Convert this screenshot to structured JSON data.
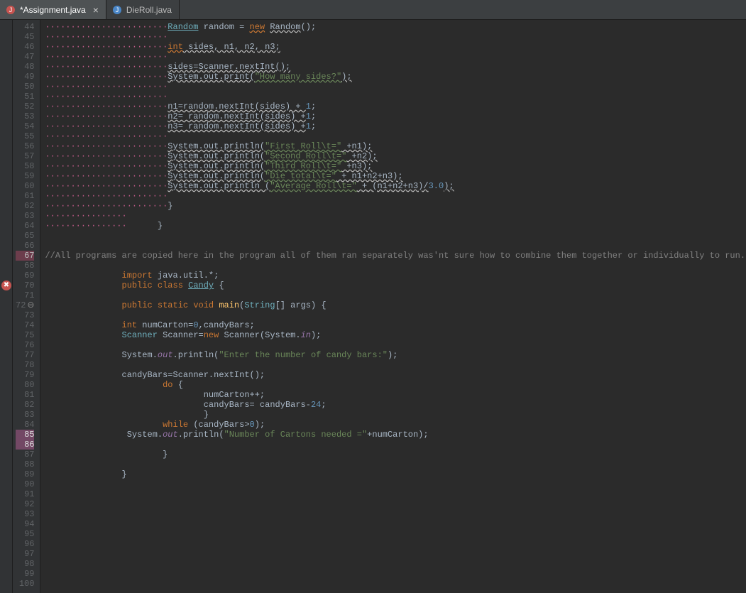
{
  "tabs": {
    "active": {
      "label": "*Assignment.java"
    },
    "inactive": {
      "label": "DieRoll.java"
    }
  },
  "gutter": {
    "start": 44,
    "end": 100,
    "quickfix_lines": [
      67
    ],
    "quickfix2_lines": [
      85,
      86
    ],
    "fold_line": 72
  },
  "marker": {
    "error_at": 70
  },
  "code": {
    "dots4": "················",
    "dots2": "········",
    "l44": {
      "a": "Random",
      "b": " random = ",
      "c": "new",
      "d": " ",
      "e": "Random",
      "f": "();"
    },
    "l46": {
      "a": "int",
      "b": " sides, n1, n2, n3;"
    },
    "l48": "sides=Scanner.nextInt();",
    "l49": {
      "a": "System.out.print(",
      "b": "\"How many sides?\"",
      "c": ");"
    },
    "l52": {
      "a": "n1=random.nextInt(sides) + ",
      "b": "1",
      "c": ";"
    },
    "l53": {
      "a": "n2= random.nextInt(sides) +",
      "b": "1",
      "c": ";"
    },
    "l54": {
      "a": "n3= random.nextInt(sides) +",
      "b": "1",
      "c": ";"
    },
    "l56": {
      "a": "System.out.println(",
      "b": "\"First Roll\\t=\"",
      "c": " +n1);"
    },
    "l57": {
      "a": "System.out.println(",
      "b": "\"Second Roll\\t=\"",
      "c": " +n2);"
    },
    "l58": {
      "a": "System.out.println(",
      "b": "\"Third Roll\\t=\"",
      "c": " +n3);"
    },
    "l59": {
      "a": "System.out.println(",
      "b": "\"Die total\\t=\"",
      "c": " + n1+n2+n3);"
    },
    "l60": {
      "a": "System.out.println (",
      "b": "\"Average Roll\\t=\"",
      "c": " + (n1+n2+n3)/",
      "d": "3.0",
      "e": ");"
    },
    "l62": "}",
    "l64": "}",
    "l67": "//All programs are copied here in the program all of them ran separately was'nt sure how to combine them together or individually to run.",
    "l69": {
      "a": "import",
      "b": " java.util.*;"
    },
    "l70": {
      "a": "public class ",
      "b": "Candy",
      "c": " {"
    },
    "l72": {
      "a": "public static void ",
      "b": "main",
      "c": "(",
      "d": "String",
      "e": "[] ",
      "f": "args",
      "g": ") {"
    },
    "l74": {
      "a": "int",
      "b": " numCarton=",
      "c": "0",
      "d": ",candyBars;"
    },
    "l75": {
      "a": "Scanner",
      "b": " Scanner=",
      "c": "new",
      "d": " Scanner(System.",
      "e": "in",
      "f": ");"
    },
    "l77": {
      "a": "System.",
      "b": "out",
      "c": ".println(",
      "d": "\"Enter the number of candy bars:\"",
      "e": ");"
    },
    "l79": "candyBars=Scanner.nextInt();",
    "l80": {
      "a": "do",
      "b": " {"
    },
    "l81": "numCarton++;",
    "l82": {
      "a": "candyBars= candyBars-",
      "b": "24",
      "c": ";"
    },
    "l83": "}",
    "l84": {
      "a": "while",
      "b": " (candyBars>",
      "c": "0",
      "d": ");"
    },
    "l85": {
      "a": "System.",
      "b": "out",
      "c": ".println(",
      "d": "\"Number of Cartons needed =\"",
      "e": "+numCarton);"
    },
    "l87": "}",
    "l89": "}"
  }
}
